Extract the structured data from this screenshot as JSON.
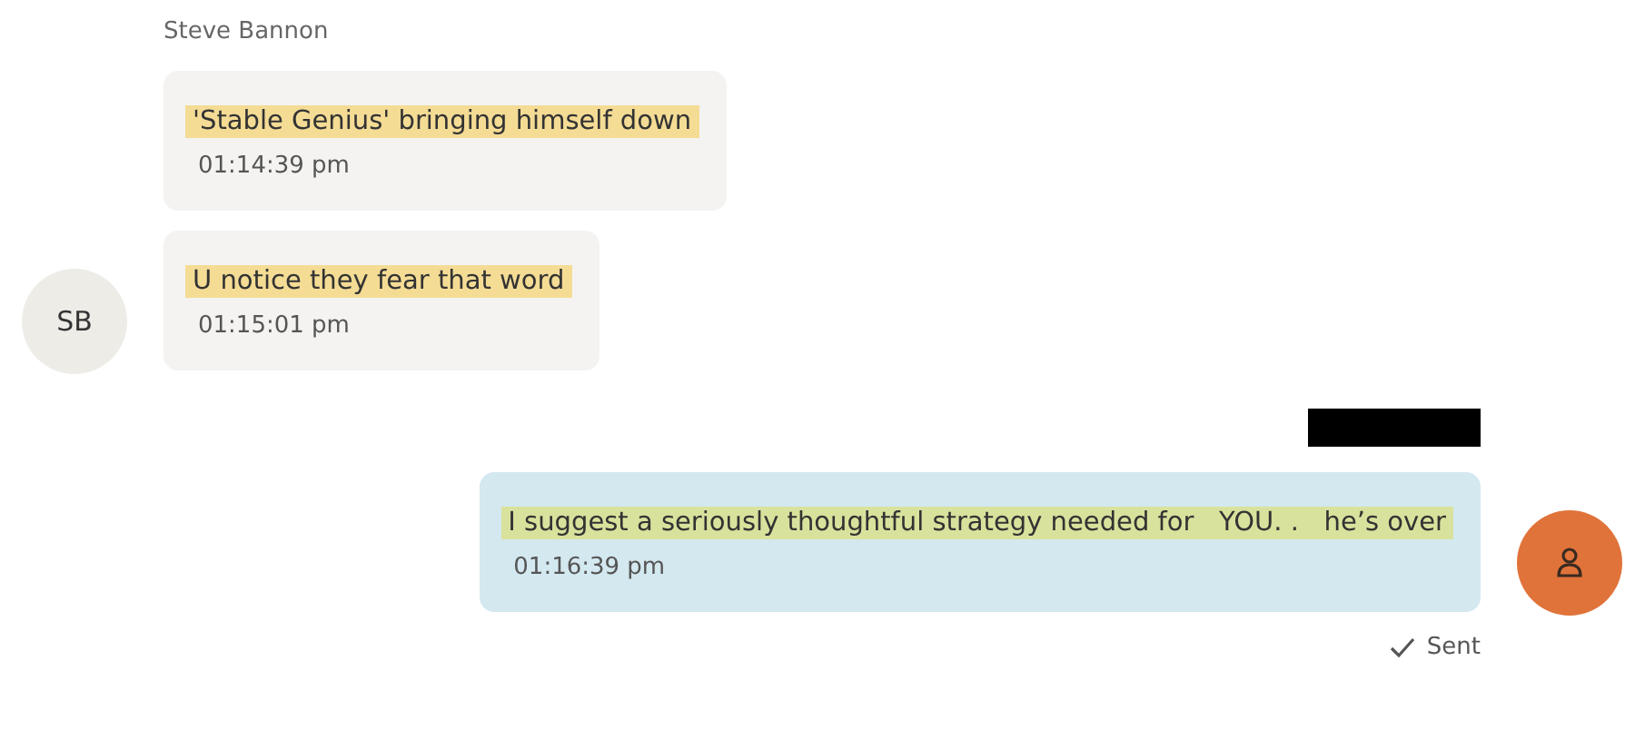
{
  "incoming": {
    "sender": "Steve Bannon",
    "avatar_initials": "SB",
    "messages": [
      {
        "text": "'Stable Genius' bringing himself down",
        "time": "01:14:39 pm",
        "highlighted": true
      },
      {
        "text": "U notice they fear that word",
        "time": "01:15:01 pm",
        "highlighted": true
      }
    ]
  },
  "outgoing": {
    "sender_redacted": true,
    "messages": [
      {
        "text": "I suggest a seriously thoughtful strategy needed for   YOU. .   he’s over",
        "time": "01:16:39 pm",
        "highlighted": true
      }
    ],
    "status": "Sent"
  }
}
